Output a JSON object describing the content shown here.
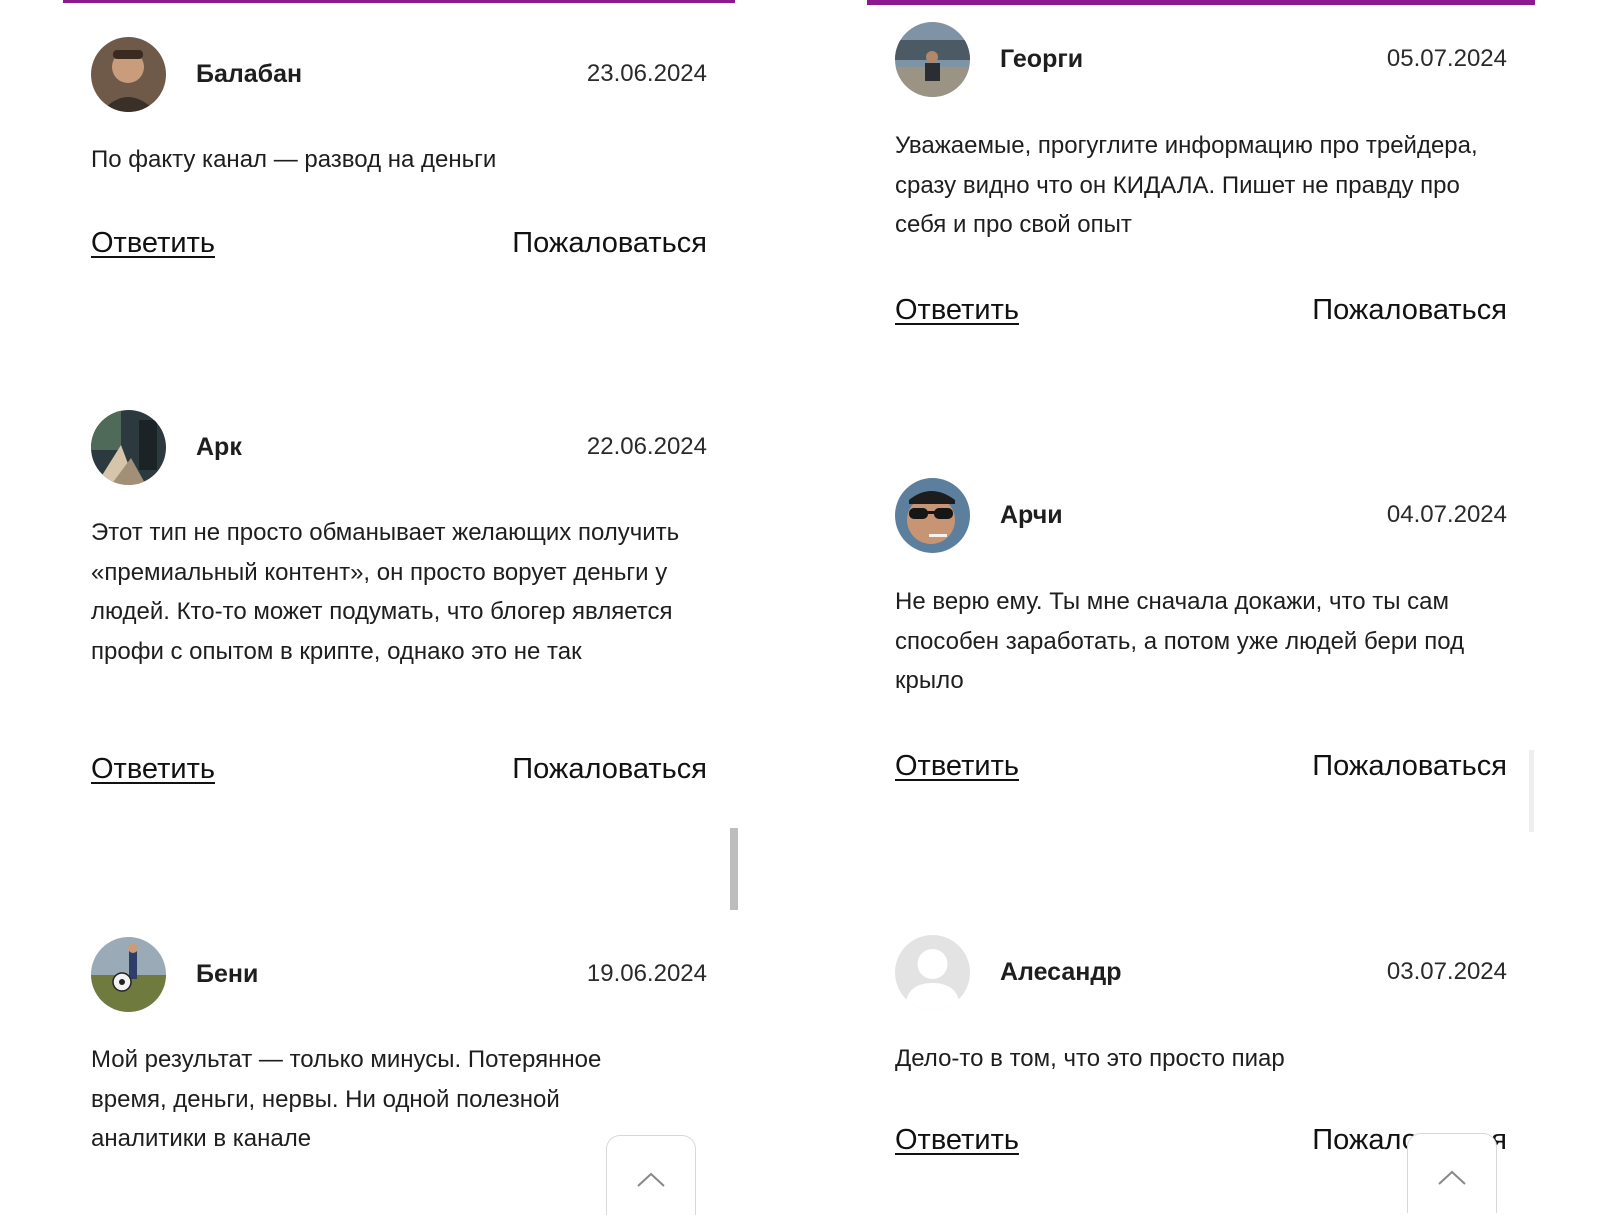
{
  "left_column": {
    "comments": [
      {
        "author": "Балабан",
        "date": "23.06.2024",
        "text": "По факту канал — развод на деньги",
        "reply_label": "Ответить",
        "report_label": "Пожаловаться",
        "avatar": "user-photo-avatar"
      },
      {
        "author": "Арк",
        "date": "22.06.2024",
        "text": "Этот тип не просто обманывает желающих получить «премиальный контент», он просто ворует деньги у людей. Кто-то может подумать, что блогер является профи с опытом в крипте, однако это не так",
        "reply_label": "Ответить",
        "report_label": "Пожаловаться",
        "avatar": "user-photo-avatar"
      },
      {
        "author": "Бени",
        "date": "19.06.2024",
        "text": "Мой результат — только минусы. Потерянное время, деньги, нервы. Ни одной полезной аналитики в канале",
        "avatar": "user-photo-avatar"
      }
    ]
  },
  "right_column": {
    "comments": [
      {
        "author": "Георги",
        "date": "05.07.2024",
        "text": "Уважаемые, прогуглите информацию про трейдера, сразу видно что он КИДАЛА. Пишет не правду про себя и про свой опыт",
        "reply_label": "Ответить",
        "report_label": "Пожаловаться",
        "avatar": "user-photo-avatar"
      },
      {
        "author": "Арчи",
        "date": "04.07.2024",
        "text": "Не верю ему. Ты мне сначала докажи, что ты сам способен заработать, а потом уже людей бери под крыло",
        "reply_label": "Ответить",
        "report_label": "Пожаловаться",
        "avatar": "user-photo-avatar"
      },
      {
        "author": "Алесандр",
        "date": "03.07.2024",
        "text": "Дело-то в том, что это просто пиар",
        "reply_label": "Ответить",
        "report_label": "Пожаловаться",
        "avatar": "default-user-avatar"
      }
    ]
  },
  "scroll_to_top_icon": "chevron-up-icon",
  "colors": {
    "accent_bar": "#8b1a8e",
    "text": "#1e1e1e",
    "scrollbar": "#bdbdbd"
  }
}
